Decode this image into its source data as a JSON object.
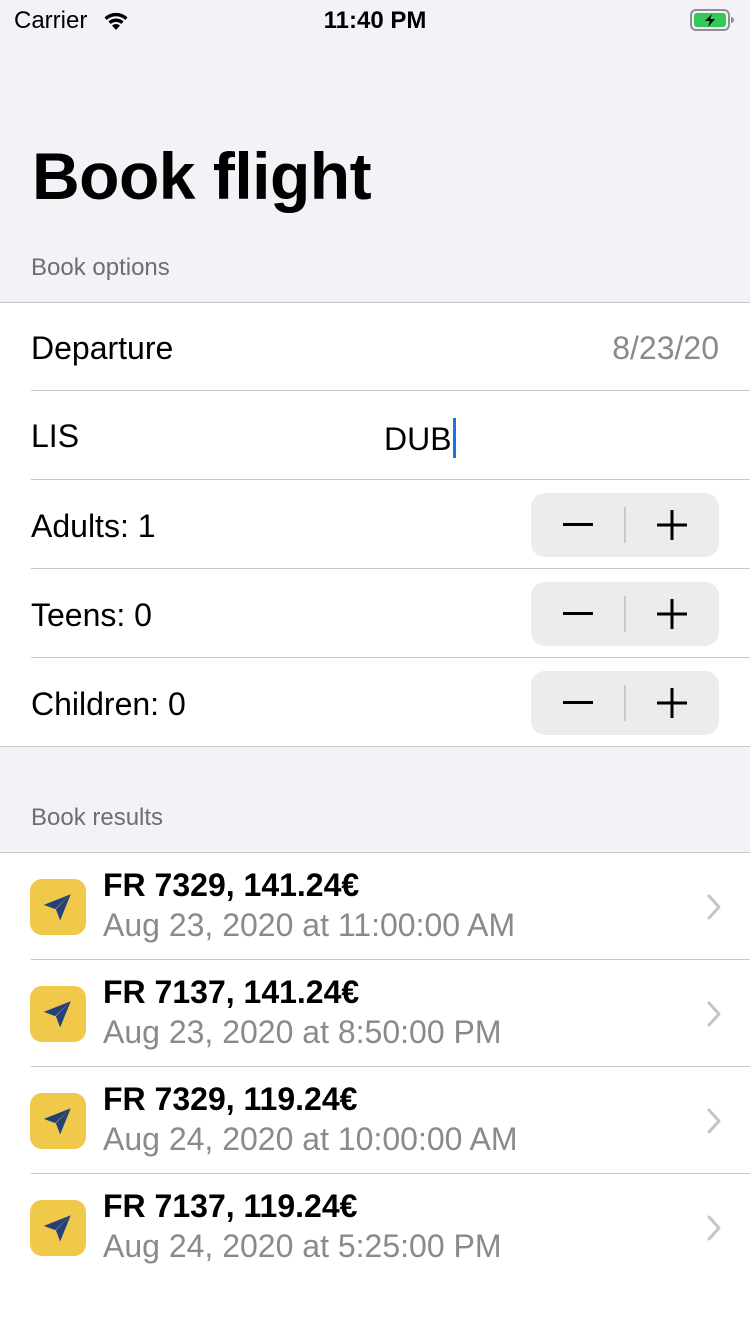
{
  "status_bar": {
    "carrier": "Carrier",
    "time": "11:40 PM",
    "battery_color": "#34c759"
  },
  "title": "Book flight",
  "options": {
    "header": "Book options",
    "departure_label": "Departure",
    "departure_value": "8/23/20",
    "from": "LIS",
    "to": "DUB",
    "adults": "Adults: 1",
    "teens": "Teens: 0",
    "children": "Children: 0",
    "minus": "−",
    "plus": "+"
  },
  "results": {
    "header": "Book results",
    "badge_color": "#f0c84a",
    "icon_color": "#25407a",
    "items": [
      {
        "title": "FR 7329, 141.24€",
        "subtitle": "Aug 23, 2020 at 11:00:00 AM"
      },
      {
        "title": "FR 7137, 141.24€",
        "subtitle": "Aug 23, 2020 at 8:50:00 PM"
      },
      {
        "title": "FR 7329, 119.24€",
        "subtitle": "Aug 24, 2020 at 10:00:00 AM"
      },
      {
        "title": "FR 7137, 119.24€",
        "subtitle": "Aug 24, 2020 at 5:25:00 PM"
      }
    ]
  },
  "icons": [
    "wifi-icon",
    "battery-icon",
    "minus-icon",
    "plus-icon",
    "paper-plane-icon",
    "chevron-right-icon"
  ]
}
